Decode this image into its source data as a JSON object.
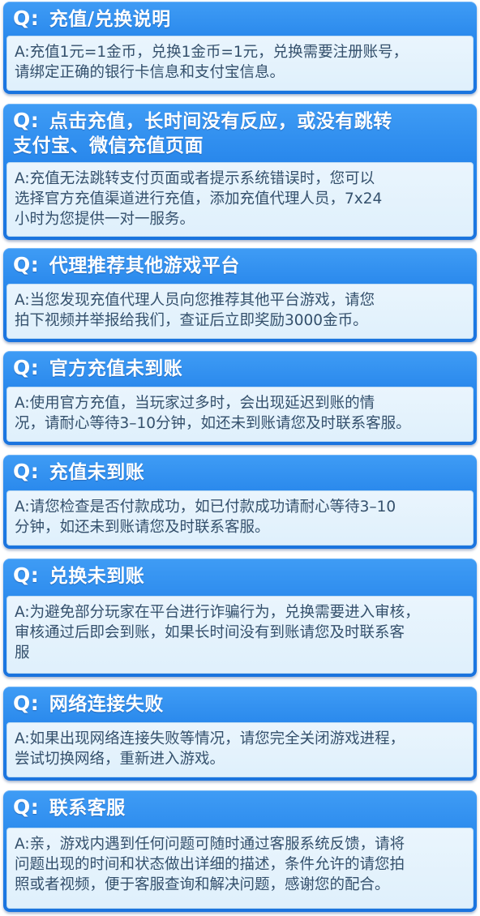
{
  "faq": [
    {
      "question_lines": [
        "充值/兑换说明"
      ],
      "answer_lines": [
        "A:充值1元=1金币，兑换1金币=1元，兑换需要注册账号，",
        "请绑定正确的银行卡信息和支付宝信息。"
      ]
    },
    {
      "question_lines": [
        "点击充值，长时间没有反应，或没有跳转",
        "支付宝、微信充值页面"
      ],
      "answer_lines": [
        "A:充值无法跳转支付页面或者提示系统错误时，您可以",
        "选择官方充值渠道进行充值，添加充值代理人员，7x24",
        "小时为您提供一对一服务。"
      ]
    },
    {
      "question_lines": [
        "代理推荐其他游戏平台"
      ],
      "answer_lines": [
        "A:当您发现充值代理人员向您推荐其他平台游戏，请您",
        "拍下视频并举报给我们，查证后立即奖励3000金币。"
      ]
    },
    {
      "question_lines": [
        "官方充值未到账"
      ],
      "answer_lines": [
        "A:使用官方充值，当玩家过多时，会出现延迟到账的情",
        "况，请耐心等待3–10分钟，如还未到账请您及时联系客服。"
      ]
    },
    {
      "question_lines": [
        "充值未到账"
      ],
      "answer_lines": [
        "A:请您检查是否付款成功，如已付款成功请耐心等待3–10",
        "分钟，如还未到账请您及时联系客服。"
      ]
    },
    {
      "question_lines": [
        "兑换未到账"
      ],
      "answer_lines": [
        "A:为避免部分玩家在平台进行诈骗行为，兑换需要进入审核，",
        "审核通过后即会到账，如果长时间没有到账请您及时联系客",
        "服"
      ]
    },
    {
      "question_lines": [
        "网络连接失败"
      ],
      "answer_lines": [
        "A:如果出现网络连接失败等情况，请您完全关闭游戏进程，",
        "尝试切换网络，重新进入游戏。"
      ]
    },
    {
      "question_lines": [
        "联系客服"
      ],
      "answer_lines": [
        "A:亲，游戏内遇到任何问题可随时通过客服系统反馈，请将",
        "问题出现的时间和状态做出详细的描述，条件允许的请您拍",
        "照或者视频，便于客服查询和解决问题，感谢您的配合。"
      ]
    }
  ],
  "q_prefix": "Q:"
}
